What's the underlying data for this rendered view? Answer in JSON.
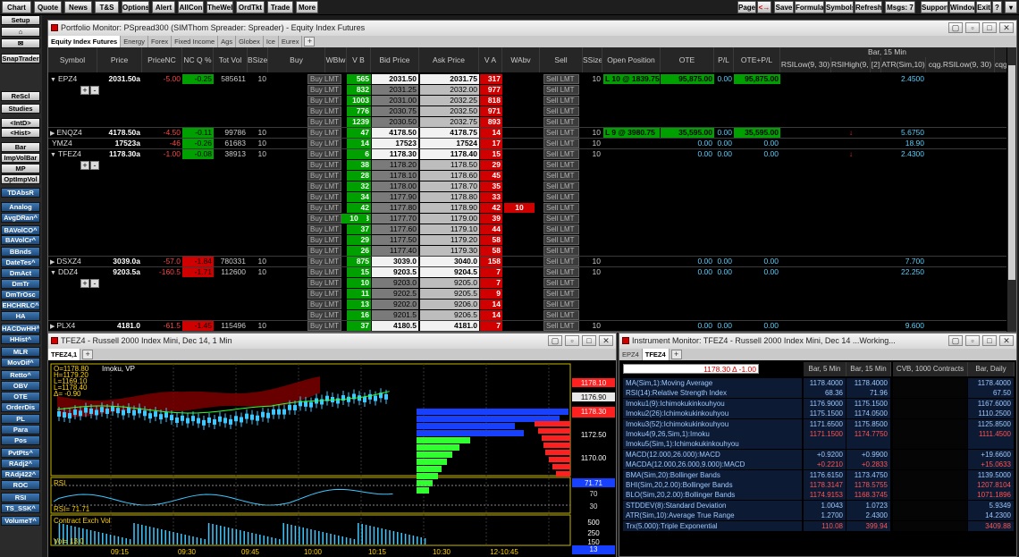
{
  "topbar": {
    "left": [
      "Chart",
      "Quote",
      "News",
      "T&S",
      "Options",
      "Alert",
      "AllCon",
      "TheWeb",
      "OrdTkt",
      "Trade",
      "More"
    ],
    "page": "Page",
    "page_arrows": "<→",
    "save": "Save",
    "formula": "Formula",
    "symbols": "Symbols",
    "refresh": "Refresh",
    "msgs": "Msgs: 7",
    "support": "Support",
    "window": "Window",
    "exit": "Exit",
    "help": "?"
  },
  "sidebar": [
    {
      "t": "Setup",
      "s": "gray"
    },
    {
      "t": "⌂",
      "s": "gray"
    },
    {
      "t": "✉",
      "s": "gray"
    },
    {
      "t": "SnapTrader",
      "s": "gray"
    },
    {
      "t": "ReScl",
      "s": "gray"
    },
    {
      "t": "Studies",
      "s": "gray"
    },
    {
      "t": "<IntD>",
      "s": "gray"
    },
    {
      "t": "<Hist>",
      "s": "gray"
    },
    {
      "t": "Bar",
      "s": "gray"
    },
    {
      "t": "ImpVolBar",
      "s": "gray"
    },
    {
      "t": "MP",
      "s": "gray"
    },
    {
      "t": "OptImpVol",
      "s": "gray"
    },
    {
      "t": "TDAbsR",
      "s": "blue"
    },
    {
      "t": "Analog",
      "s": "blue"
    },
    {
      "t": "AvgDRan^",
      "s": "blue"
    },
    {
      "t": "BAVolCO^",
      "s": "blue"
    },
    {
      "t": "BAVolCr^",
      "s": "blue"
    },
    {
      "t": "BBnds",
      "s": "blue"
    },
    {
      "t": "DateTes^",
      "s": "blue"
    },
    {
      "t": "DmAct",
      "s": "blue"
    },
    {
      "t": "DmTr",
      "s": "blue"
    },
    {
      "t": "DmTrOsc",
      "s": "blue"
    },
    {
      "t": "EHCHRLC^",
      "s": "blue"
    },
    {
      "t": "HA",
      "s": "blue"
    },
    {
      "t": "HACDwHH^",
      "s": "blue"
    },
    {
      "t": "HHist^",
      "s": "blue"
    },
    {
      "t": "MLR",
      "s": "blue"
    },
    {
      "t": "MovDif^",
      "s": "blue"
    },
    {
      "t": "Retto^",
      "s": "blue"
    },
    {
      "t": "OBV",
      "s": "blue"
    },
    {
      "t": "OTE",
      "s": "blue"
    },
    {
      "t": "OrderDis",
      "s": "blue"
    },
    {
      "t": "PL",
      "s": "blue"
    },
    {
      "t": "Para",
      "s": "blue"
    },
    {
      "t": "Pos",
      "s": "blue"
    },
    {
      "t": "PvtPts^",
      "s": "blue"
    },
    {
      "t": "RAdj2^",
      "s": "blue"
    },
    {
      "t": "RAdj422^",
      "s": "blue"
    },
    {
      "t": "ROC",
      "s": "blue"
    },
    {
      "t": "RSI",
      "s": "blue"
    },
    {
      "t": "TS_SSK^",
      "s": "blue"
    },
    {
      "t": "VolumeT^",
      "s": "blue"
    }
  ],
  "portfolio": {
    "title": "Portfolio Monitor: PSpread300 (SIMThom Spreader: Spreader) - Equity Index Futures",
    "tabs": [
      "Equity Index Futures",
      "Energy",
      "Forex",
      "Fixed Income",
      "Ags",
      "Globex",
      "Ice",
      "Eurex"
    ],
    "headers": [
      "Symbol",
      "Price",
      "PriceNC",
      "NC Q %",
      "Tot Vol",
      "BSize",
      "Buy",
      "WBlw",
      "V B",
      "Bid Price",
      "Ask Price",
      "V A",
      "WAbv",
      "Sell",
      "SSize",
      "Open Position",
      "OTE",
      "P/L",
      "OTE+P/L"
    ],
    "grp1": "Bar, 15 Min",
    "grp1_cols": [
      "RSILow(9, 30)",
      "RSIHigh(9, 60)",
      "[2]",
      "ATR(Sim,10)"
    ],
    "grp2": "Bar, 30 Min",
    "grp2_cols": [
      "cqg.RSILow(9, 30)",
      "cqg.RSIHi"
    ],
    "buy_label": "Buy LMT",
    "sell_label": "Sell LMT",
    "working": {
      "qty": "10",
      "row": "TFEZ4",
      "price": "1177.90",
      "ask": "1179.00"
    }
  },
  "symbols": [
    {
      "sym": "EPZ4",
      "exp": "▼",
      "price": "2031.50a",
      "nc": "-5.00",
      "ncq": "-0.25",
      "vol": "585611",
      "bsize": "10",
      "ssize": "10",
      "pos": "L  10 @ 1839.75",
      "ote": "95,875.00",
      "pl": "0.00",
      "otepl": "95,875.00",
      "atr": "2.4500",
      "ladder": [
        [
          "565",
          "2031.50",
          "2031.75",
          "317"
        ],
        [
          "832",
          "2031.25",
          "2032.00",
          "977"
        ],
        [
          "1003",
          "2031.00",
          "2032.25",
          "818"
        ],
        [
          "776",
          "2030.75",
          "2032.50",
          "971"
        ],
        [
          "1239",
          "2030.50",
          "2032.75",
          "893"
        ]
      ]
    },
    {
      "sym": "ENQZ4",
      "exp": "▶",
      "price": "4178.50a",
      "nc": "-4.50",
      "ncq": "-0.11",
      "vol": "99786",
      "bsize": "10",
      "ssize": "10",
      "pos": "L   9 @ 3980.75",
      "ote": "35,595.00",
      "pl": "0.00",
      "otepl": "35,595.00",
      "atr": "5.6750",
      "arrow": "↓",
      "ladder": [
        [
          "47",
          "4178.50",
          "4178.75",
          "14"
        ]
      ]
    },
    {
      "sym": "YMZ4",
      "exp": "",
      "price": "17523a",
      "nc": "-46",
      "ncq": "-0.26",
      "vol": "61683",
      "bsize": "10",
      "ssize": "10",
      "pos": "",
      "ote": "0.00",
      "pl": "0.00",
      "otepl": "0.00",
      "atr": "18.90",
      "ladder": [
        [
          "14",
          "17523",
          "17524",
          "17"
        ]
      ]
    },
    {
      "sym": "TFEZ4",
      "exp": "▼",
      "price": "1178.30a",
      "nc": "-1.00",
      "ncq": "-0.08",
      "vol": "38913",
      "bsize": "10",
      "ssize": "10",
      "pos": "",
      "ote": "0.00",
      "pl": "0.00",
      "otepl": "0.00",
      "atr": "2.4300",
      "arrow": "↓",
      "ladder": [
        [
          "6",
          "1178.30",
          "1178.40",
          "15"
        ],
        [
          "38",
          "1178.20",
          "1178.50",
          "29"
        ],
        [
          "28",
          "1178.10",
          "1178.60",
          "45"
        ],
        [
          "32",
          "1178.00",
          "1178.70",
          "35"
        ],
        [
          "34",
          "1177.90",
          "1178.80",
          "33"
        ],
        [
          "42",
          "1177.80",
          "1178.90",
          "42"
        ],
        [
          "33",
          "1177.70",
          "1179.00",
          "39"
        ],
        [
          "37",
          "1177.60",
          "1179.10",
          "44"
        ],
        [
          "29",
          "1177.50",
          "1179.20",
          "58"
        ],
        [
          "26",
          "1177.40",
          "1179.30",
          "58"
        ]
      ]
    },
    {
      "sym": "DSXZ4",
      "exp": "▶",
      "price": "3039.0a",
      "nc": "-57.0",
      "ncq": "-1.84",
      "vol": "780331",
      "bsize": "10",
      "ssize": "10",
      "pos": "",
      "ote": "0.00",
      "pl": "0.00",
      "otepl": "0.00",
      "atr": "7.700",
      "ladder": [
        [
          "875",
          "3039.0",
          "3040.0",
          "158"
        ]
      ]
    },
    {
      "sym": "DDZ4",
      "exp": "▼",
      "price": "9203.5a",
      "nc": "-160.5",
      "ncq": "-1.71",
      "vol": "112600",
      "bsize": "10",
      "ssize": "10",
      "pos": "",
      "ote": "0.00",
      "pl": "0.00",
      "otepl": "0.00",
      "atr": "22.250",
      "ladder": [
        [
          "15",
          "9203.5",
          "9204.5",
          "7"
        ],
        [
          "10",
          "9203.0",
          "9205.0",
          "7"
        ],
        [
          "11",
          "9202.5",
          "9205.5",
          "9"
        ],
        [
          "13",
          "9202.0",
          "9206.0",
          "14"
        ],
        [
          "16",
          "9201.5",
          "9206.5",
          "14"
        ]
      ]
    },
    {
      "sym": "PLX4",
      "exp": "▶",
      "price": "4181.0",
      "nc": "-61.5",
      "ncq": "-1.45",
      "vol": "115496",
      "bsize": "10",
      "ssize": "10",
      "pos": "",
      "ote": "0.00",
      "pl": "0.00",
      "otepl": "0.00",
      "atr": "9.600",
      "ladder": [
        [
          "37",
          "4180.5",
          "4181.0",
          "7"
        ]
      ]
    }
  ],
  "chart": {
    "title": "TFEZ4 - Russell 2000 Index Mini, Dec 14, 1 Min",
    "tab": "TFEZ4,1",
    "ohlc": [
      "O=1178.80",
      "H=1179.20",
      "L=1169.10",
      "L=1178.40",
      "Δ=  -0.90"
    ],
    "study": "Imoku, VP",
    "prices": [
      "1178.10",
      "1176.90",
      "1174.30",
      "1172.50",
      "1170.00"
    ],
    "last": "1178.30",
    "rsi_label": "RSI",
    "rsi_val": "RSI=     71.71",
    "rsi_right": "71.71",
    "rsi_ticks": [
      "70",
      "30"
    ],
    "vol_label": "Contract Exch Vol",
    "vol_val": "Vol=        13.0",
    "vol_ticks": [
      "500",
      "250",
      "150",
      "13"
    ],
    "times": [
      "09:15",
      "09:30",
      "09:45",
      "10:00",
      "10:15",
      "10:30",
      "12-10:45"
    ]
  },
  "instrument": {
    "title": "Instrument Monitor: TFEZ4 - Russell 2000 Index Mini, Dec 14   ...Working...",
    "tabs": [
      "EPZ4",
      "TFEZ4"
    ],
    "quote": "1178.30  Δ  -1.00",
    "cols": [
      "Bar, 5 Min",
      "Bar, 15 Min",
      "CVB, 1000 Contracts",
      "Bar, Daily"
    ],
    "rows": [
      {
        "n": "MA(Sim,1):Moving Average",
        "v": [
          "1178.4000",
          "1178.4000",
          "",
          "1178.4000"
        ],
        "red": false
      },
      {
        "n": "RSI(14):Relative Strength Index",
        "v": [
          "68.36",
          "71.96",
          "",
          "67.50"
        ],
        "red": false
      },
      {
        "n": "Imoku1(9):Ichimokukinkouhyou",
        "v": [
          "1176.9000",
          "1175.1500",
          "",
          "1167.6000"
        ],
        "red": false
      },
      {
        "n": "Imoku2(26):Ichimokukinkouhyou",
        "v": [
          "1175.1500",
          "1174.0500",
          "",
          "1110.2500"
        ],
        "red": false
      },
      {
        "n": "Imoku3(52):Ichimokukinkouhyou",
        "v": [
          "1171.6500",
          "1175.8500",
          "",
          "1125.8500"
        ],
        "red": false
      },
      {
        "n": "Imoku4(9,26,Sim,1):Imoku",
        "v": [
          "1171.1500",
          "1174.7750",
          "",
          "1111.4500"
        ],
        "red": true
      },
      {
        "n": "Imoku5(Sim,1):Ichimokukinkouhyou",
        "v": [
          "",
          "",
          "",
          ""
        ],
        "red": false
      },
      {
        "n": "MACD(12.000,26.000):MACD",
        "v": [
          "+0.9200",
          "+0.9900",
          "",
          "+19.6600"
        ],
        "red": false
      },
      {
        "n": "MACDA(12.000,26.000,9.000):MACD",
        "v": [
          "+0.2210",
          "+0.2833",
          "",
          "+15.0633"
        ],
        "red": true
      },
      {
        "n": "BMA(Sim,20):Bollinger Bands",
        "v": [
          "1176.6150",
          "1173.4750",
          "",
          "1139.5000"
        ],
        "red": false
      },
      {
        "n": "BHI(Sim,20,2.00):Bollinger Bands",
        "v": [
          "1178.3147",
          "1178.5755",
          "",
          "1207.8104"
        ],
        "red": true
      },
      {
        "n": "BLO(Sim,20,2.00):Bollinger Bands",
        "v": [
          "1174.9153",
          "1168.3745",
          "",
          "1071.1896"
        ],
        "red": true
      },
      {
        "n": "STDDEV(8):Standard Deviation",
        "v": [
          "1.0043",
          "1.0723",
          "",
          "5.9349"
        ],
        "red": false
      },
      {
        "n": "ATR(Sim,10):Average True Range",
        "v": [
          "1.2700",
          "2.4300",
          "",
          "14.2300"
        ],
        "red": false
      },
      {
        "n": "Trx(5.000):Triple Exponential",
        "v": [
          "110.08",
          "399.94",
          "",
          "3409.88"
        ],
        "red": true
      }
    ]
  }
}
